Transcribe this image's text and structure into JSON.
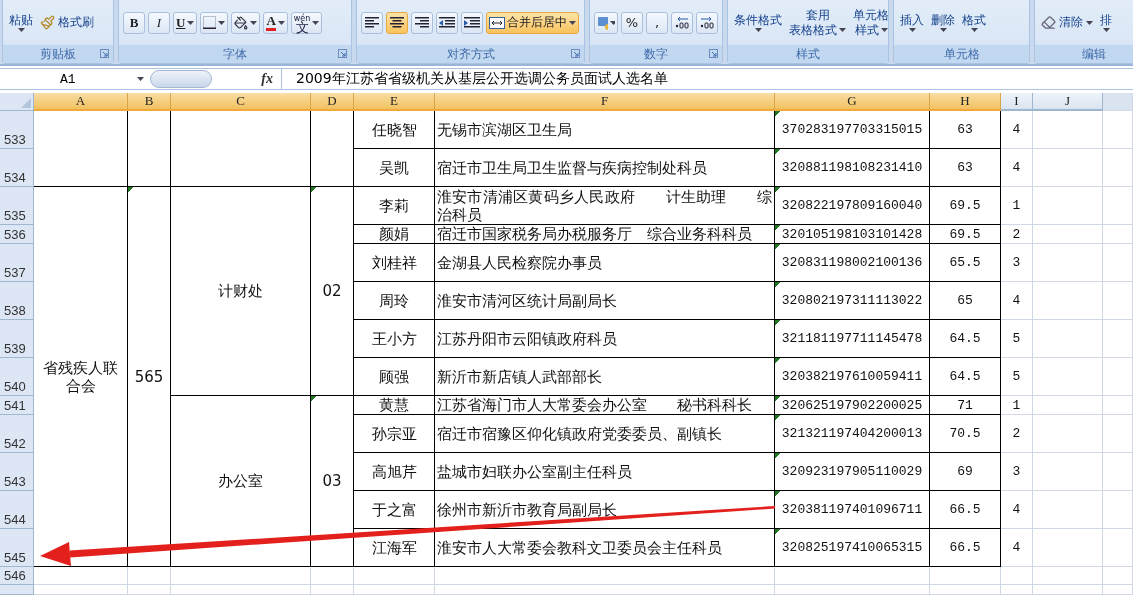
{
  "ribbon": {
    "groups": [
      {
        "label": "剪贴板",
        "launcher": true,
        "items": [
          {
            "kind": "large",
            "lines": [
              "粘贴"
            ]
          },
          {
            "kind": "brush",
            "label": "格式刷"
          }
        ]
      },
      {
        "label": "字体",
        "launcher": true,
        "items": [
          {
            "kind": "bold",
            "label": "B"
          },
          {
            "kind": "italic",
            "label": "I"
          },
          {
            "kind": "underline",
            "label": "U"
          },
          {
            "kind": "borders"
          },
          {
            "kind": "fill"
          },
          {
            "kind": "fontcolor",
            "label": "A"
          },
          {
            "kind": "phonetic",
            "label": "文",
            "ruby": "wén"
          }
        ]
      },
      {
        "label": "对齐方式",
        "launcher": true,
        "items": [
          {
            "kind": "alignleft",
            "selected": false
          },
          {
            "kind": "aligncenter",
            "selected": true
          },
          {
            "kind": "alignright",
            "selected": false
          },
          {
            "kind": "outdent"
          },
          {
            "kind": "indent"
          },
          {
            "kind": "merge",
            "label": "合并后居中",
            "selected": true
          }
        ]
      },
      {
        "label": "数字",
        "launcher": true,
        "items": [
          {
            "kind": "currency"
          },
          {
            "kind": "text",
            "label": "%"
          },
          {
            "kind": "text",
            "label": ","
          },
          {
            "kind": "decimalmore"
          },
          {
            "kind": "decimalless"
          }
        ]
      },
      {
        "label": "样式",
        "launcher": false,
        "items": [
          {
            "kind": "large",
            "lines": [
              "条件格式"
            ]
          },
          {
            "kind": "large",
            "lines": [
              "套用",
              "表格格式"
            ]
          },
          {
            "kind": "large",
            "lines": [
              "单元格",
              "样式"
            ]
          }
        ]
      },
      {
        "label": "单元格",
        "launcher": false,
        "items": [
          {
            "kind": "large",
            "lines": [
              "插入"
            ]
          },
          {
            "kind": "large",
            "lines": [
              "删除"
            ]
          },
          {
            "kind": "large",
            "lines": [
              "格式"
            ]
          }
        ]
      },
      {
        "label": "编辑",
        "items": [
          {
            "kind": "eraser",
            "label": "清除"
          },
          {
            "kind": "large",
            "lines": [
              "排"
            ]
          }
        ]
      }
    ]
  },
  "formula_bar": {
    "name_box": "A1",
    "function_label": "fx",
    "formula": "2009年江苏省省级机关从基层公开选调公务员面试人选名单"
  },
  "sheet": {
    "columns": [
      {
        "label": "A",
        "selected": true
      },
      {
        "label": "B",
        "selected": true
      },
      {
        "label": "C",
        "selected": true
      },
      {
        "label": "D",
        "selected": true
      },
      {
        "label": "E",
        "selected": true
      },
      {
        "label": "F",
        "selected": true
      },
      {
        "label": "G",
        "selected": true
      },
      {
        "label": "H",
        "selected": true
      },
      {
        "label": "I",
        "selected": false
      },
      {
        "label": "J",
        "selected": false
      }
    ],
    "blocks": [
      {
        "code_warning": false,
        "offices": [
          {
            "code_warning": false,
            "people": [
              {
                "row": "533",
                "kind": "normal",
                "name": "任晓智",
                "unit": "无锡市滨湖区卫生局",
                "id": "370283197703315015",
                "id_warning": true,
                "score": "63",
                "rank": "4"
              },
              {
                "row": "534",
                "kind": "normal",
                "name": "吴凯",
                "unit": "宿迁市卫生局卫生监督与疾病控制处科员",
                "id": "320881198108231410",
                "id_warning": true,
                "score": "63",
                "rank": "4"
              }
            ]
          }
        ]
      },
      {
        "agency": "省残疾人联合会",
        "code": "565",
        "code_warning": true,
        "offices": [
          {
            "office": "计财处",
            "office_code": "02",
            "code_warning": true,
            "people": [
              {
                "row": "535",
                "kind": "normal",
                "name": "李莉",
                "unit": "淮安市清浦区黄码乡人民政府　　计生助理　　综治科员",
                "id": "320822197809160040",
                "id_warning": true,
                "score": "69.5",
                "rank": "1"
              },
              {
                "row": "536",
                "kind": "short",
                "name": "颜娟",
                "unit": "宿迁市国家税务局办税服务厅　综合业务科科员",
                "id": "320105198103101428",
                "id_warning": true,
                "score": "69.5",
                "rank": "2"
              },
              {
                "row": "537",
                "kind": "normal",
                "name": "刘桂祥",
                "unit": "金湖县人民检察院办事员",
                "id": "320831198002100136",
                "id_warning": true,
                "score": "65.5",
                "rank": "3"
              },
              {
                "row": "538",
                "kind": "normal",
                "name": "周玲",
                "unit": "淮安市清河区统计局副局长",
                "id": "320802197311113022",
                "id_warning": true,
                "score": "65",
                "rank": "4"
              },
              {
                "row": "539",
                "kind": "normal",
                "name": "王小方",
                "unit": "江苏丹阳市云阳镇政府科员",
                "id": "321181197711145478",
                "id_warning": true,
                "score": "64.5",
                "rank": "5"
              },
              {
                "row": "540",
                "kind": "normal",
                "name": "顾强",
                "unit": "新沂市新店镇人武部部长",
                "id": "320382197610059411",
                "id_warning": true,
                "score": "64.5",
                "rank": "5"
              }
            ]
          },
          {
            "office": "办公室",
            "office_code": "03",
            "code_warning": true,
            "people": [
              {
                "row": "541",
                "kind": "short",
                "name": "黄慧",
                "unit": "江苏省海门市人大常委会办公室　　秘书科科长",
                "id": "320625197902200025",
                "id_warning": true,
                "score": "71",
                "rank": "1"
              },
              {
                "row": "542",
                "kind": "normal",
                "name": "孙宗亚",
                "unit": "宿迁市宿豫区仰化镇政府党委委员、副镇长",
                "id": "321321197404200013",
                "id_warning": true,
                "score": "70.5",
                "rank": "2"
              },
              {
                "row": "543",
                "kind": "normal",
                "name": "高旭芹",
                "unit": "盐城市妇联办公室副主任科员",
                "id": "320923197905110029",
                "id_warning": true,
                "score": "69",
                "rank": "3"
              },
              {
                "row": "544",
                "kind": "normal",
                "name": "于之富",
                "unit": "徐州市新沂市教育局副局长",
                "id": "320381197401096711",
                "id_warning": true,
                "score": "66.5",
                "rank": "4"
              },
              {
                "row": "545",
                "kind": "normal",
                "name": "江海军",
                "unit": "淮安市人大常委会教科文卫委员会主任科员",
                "id": "320825197410065315",
                "id_warning": true,
                "score": "66.5",
                "rank": "4"
              }
            ]
          }
        ]
      }
    ],
    "empty_rows": [
      "546"
    ]
  }
}
